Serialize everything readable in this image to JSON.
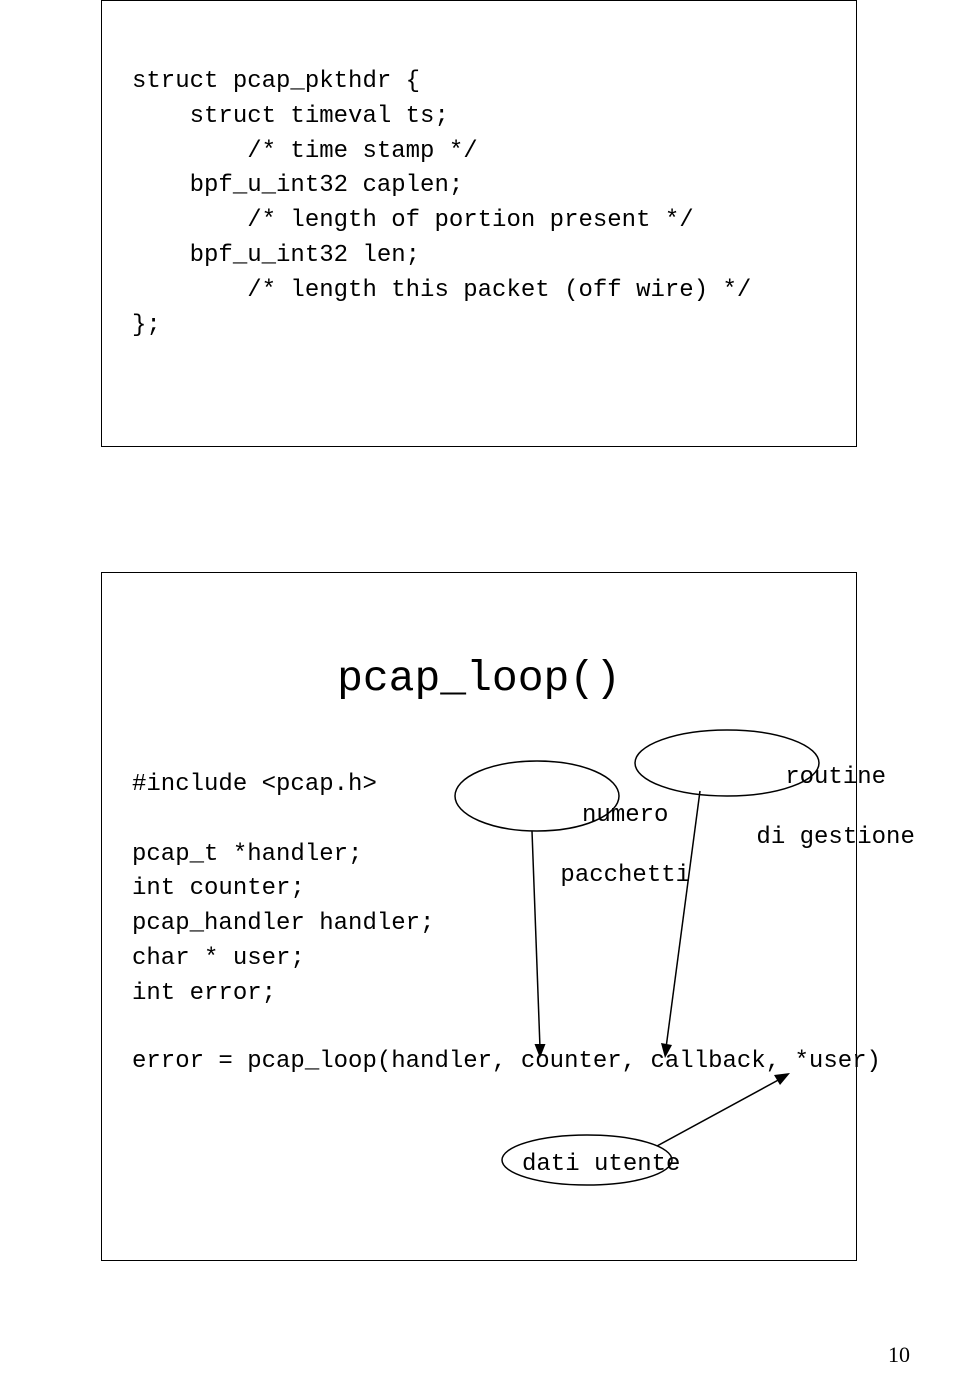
{
  "page_number": "10",
  "slide1": {
    "code": "struct pcap_pkthdr {\n    struct timeval ts;\n        /* time stamp */\n    bpf_u_int32 caplen;\n        /* length of portion present */\n    bpf_u_int32 len;\n        /* length this packet (off wire) */\n};"
  },
  "slide2": {
    "title": "pcap_loop()",
    "decls": "#include <pcap.h>\n\npcap_t *handler;\nint counter;\npcap_handler handler;\nchar * user;\nint error;",
    "label_numero_line1": "numero",
    "label_numero_line2": "pacchetti",
    "label_routine_line1": "routine",
    "label_routine_line2": "di gestione",
    "call_line": "error = pcap_loop(handler, counter, callback, *user)",
    "label_dati": "dati utente"
  }
}
